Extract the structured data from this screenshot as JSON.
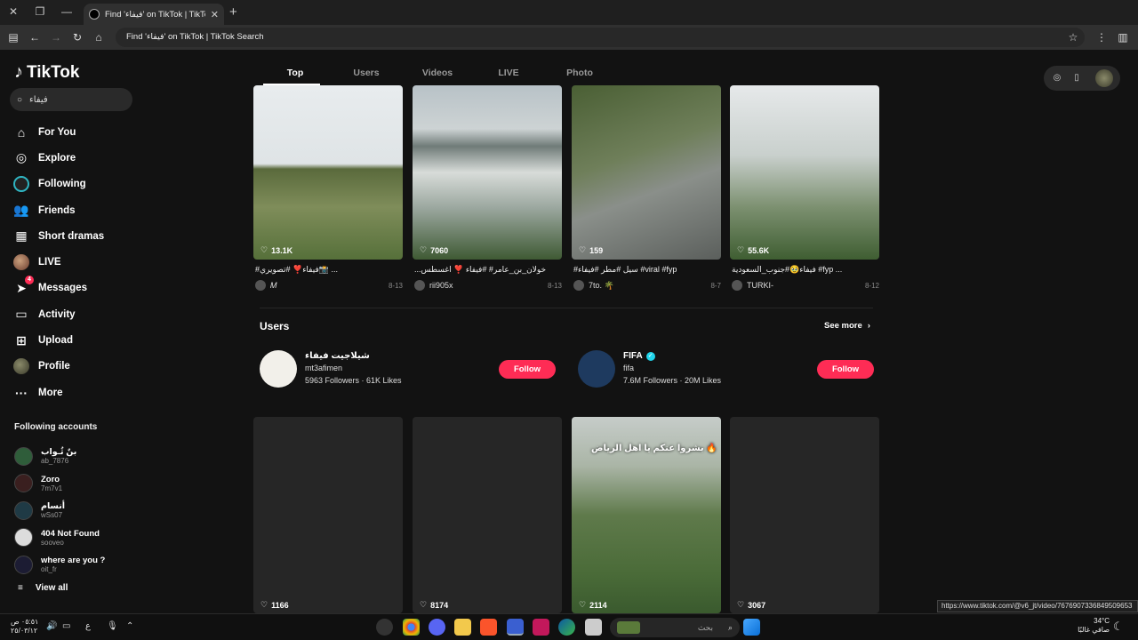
{
  "browser": {
    "tab_title": "Find 'فيفاء' on TikTok | TikTok...",
    "address": "Find 'فيفاء' on TikTok | TikTok Search",
    "status_url": "https://www.tiktok.com/@v6_jt/video/7676907336849509653"
  },
  "sidebar": {
    "logo": "TikTok",
    "search_value": "فيفاء",
    "nav": [
      {
        "label": "For You"
      },
      {
        "label": "Explore"
      },
      {
        "label": "Following"
      },
      {
        "label": "Friends"
      },
      {
        "label": "Short dramas"
      },
      {
        "label": "LIVE"
      },
      {
        "label": "Messages",
        "badge": "4"
      },
      {
        "label": "Activity"
      },
      {
        "label": "Upload"
      },
      {
        "label": "Profile"
      },
      {
        "label": "More"
      }
    ],
    "following_title": "Following accounts",
    "following": [
      {
        "name": "بنٌ ثُـواب",
        "handle": "ab_7876",
        "color": "#2f5d3a"
      },
      {
        "name": "Zoro",
        "handle": "7m7v1",
        "color": "#3a1f1f"
      },
      {
        "name": "أنسام",
        "handle": "wSs07",
        "color": "#1f3a45"
      },
      {
        "name": "404 Not Found",
        "handle": "sooveo",
        "color": "#dcdcdc"
      },
      {
        "name": "where are you ?",
        "handle": "oit_fr",
        "color": "#1c1c33"
      }
    ],
    "view_all": "View all"
  },
  "tabs": [
    "Top",
    "Users",
    "Videos",
    "LIVE",
    "Photo"
  ],
  "videos_top": [
    {
      "likes": "13.1K",
      "caption_tags": "#فيفاء❣️ #تصويري📸 ...",
      "author": "𝑀",
      "date": "8-13"
    },
    {
      "likes": "7060",
      "caption_tags": "...خولان_بن_عامر# #فيفاء ❣️ اغسطس",
      "author": "rii905x",
      "date": "8-13"
    },
    {
      "likes": "159",
      "caption_tags": "#سيل #مطر #فيفاء #viral #fyp",
      "author": "7to. 🌴",
      "date": "8-7"
    },
    {
      "likes": "55.6K",
      "caption_tags": "فيفاء🥹#جنوب_السعودية #fyp ...",
      "author": "TURKI-",
      "date": "8-12"
    }
  ],
  "users_section": {
    "title": "Users",
    "see_more": "See more",
    "users": [
      {
        "name": "شيلاجيت فيفاء",
        "handle": "mt3afimen",
        "followers": "5963 Followers",
        "likes": "61K Likes",
        "follow": "Follow",
        "verified": false
      },
      {
        "name": "FIFA",
        "handle": "fifa",
        "followers": "7.6M Followers",
        "likes": "20M Likes",
        "follow": "Follow",
        "verified": true
      }
    ]
  },
  "videos_bottom": [
    {
      "likes": "1166",
      "overlay": ""
    },
    {
      "likes": "8174",
      "overlay": ""
    },
    {
      "likes": "2114",
      "overlay": "بشروا عنكم يا اهل الرياض 🔥"
    },
    {
      "likes": "3067",
      "overlay": ""
    }
  ],
  "taskbar": {
    "time": "٠٥:٥١ ص",
    "date": "٢٥/٠٣/١٢",
    "search_placeholder": "بحث",
    "lang": "ع",
    "temp": "34°C",
    "weather": "صافي غالبًا"
  }
}
